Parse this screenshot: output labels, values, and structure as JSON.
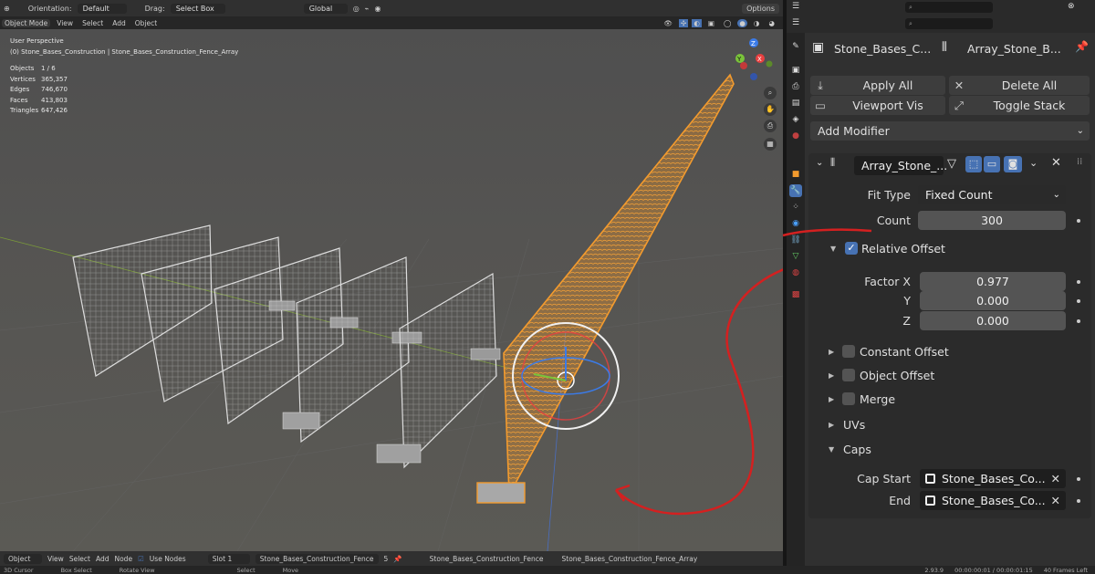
{
  "header": {
    "orientation_label": "Orientation:",
    "orientation_value": "Default",
    "drag_label": "Drag:",
    "drag_value": "Select Box",
    "transform_value": "Global",
    "options_label": "Options"
  },
  "menu": {
    "mode": "Object Mode",
    "items": [
      "View",
      "Select",
      "Add",
      "Object"
    ]
  },
  "viewport": {
    "title": "User Perspective",
    "context": "(0) Stone_Bases_Construction | Stone_Bases_Construction_Fence_Array",
    "stats": [
      {
        "k": "Objects",
        "v": "1 / 6"
      },
      {
        "k": "Vertices",
        "v": "365,357"
      },
      {
        "k": "Edges",
        "v": "746,670"
      },
      {
        "k": "Faces",
        "v": "413,803"
      },
      {
        "k": "Triangles",
        "v": "647,426"
      }
    ],
    "gizmo_axes": {
      "x": "X",
      "y": "Y",
      "z": "Z"
    }
  },
  "bottom": {
    "mode": "Object",
    "items": [
      "View",
      "Select",
      "Add",
      "Node"
    ],
    "use_nodes": "Use Nodes",
    "slot": "Slot 1",
    "material": "Stone_Bases_Construction_Fence",
    "users": "5",
    "crumb_obj": "Stone_Bases_Construction_Fence",
    "crumb_mod": "Stone_Bases_Construction_Fence_Array"
  },
  "status": {
    "items": [
      "3D Cursor",
      "Box Select",
      "Rotate View",
      "Select",
      "Move"
    ],
    "right": [
      "2.93.9",
      "00:00:00:01 / 00:00:01:15",
      "40 Frames Left"
    ]
  },
  "properties": {
    "object_name": "Stone_Bases_C...",
    "modifier_crumb": "Array_Stone_B...",
    "apply_all": "Apply All",
    "delete_all": "Delete All",
    "viewport_vis": "Viewport Vis",
    "toggle_stack": "Toggle Stack",
    "add_modifier": "Add Modifier",
    "modifier_name": "Array_Stone_...",
    "fit_type_label": "Fit Type",
    "fit_type_value": "Fixed Count",
    "count_label": "Count",
    "count_value": "300",
    "relative_offset": "Relative Offset",
    "factor_x_label": "Factor X",
    "factor_x": "0.977",
    "y_label": "Y",
    "factor_y": "0.000",
    "z_label": "Z",
    "factor_z": "0.000",
    "constant_offset": "Constant Offset",
    "object_offset": "Object Offset",
    "merge": "Merge",
    "uvs": "UVs",
    "caps": "Caps",
    "cap_start_label": "Cap Start",
    "cap_start_value": "Stone_Bases_Co...",
    "end_label": "End",
    "end_value": "Stone_Bases_Co..."
  },
  "colors": {
    "accent": "#4772b3",
    "selection_orange": "#f39b2e",
    "annotation_red": "#d42020"
  }
}
